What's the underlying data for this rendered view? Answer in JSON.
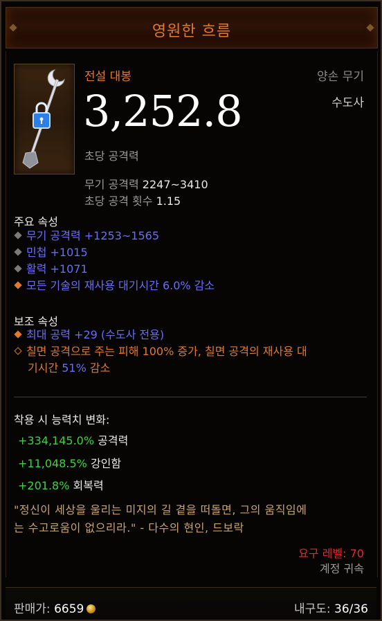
{
  "item": {
    "name": "영원한 흐름",
    "type": "전설 대봉",
    "slot": "양손 무기",
    "class": "수도사",
    "dps": "3,252.8",
    "dps_label": "초당 공격력",
    "damage_label": "무기 공격력",
    "damage_value": "2247~3410",
    "aps_label": "초당 공격 횟수",
    "aps_value": "1.15",
    "icon": "daibo-staff-with-lock-icon"
  },
  "primary": {
    "heading": "주요 속성",
    "affixes": [
      "무기 공격력 +1253~1565",
      "민첩 +1015",
      "활력 +1071",
      "모든 기술의 재사용 대기시간 6.0% 감소"
    ]
  },
  "secondary": {
    "heading": "보조 속성",
    "affixes": [
      "최대 공력 +29 (수도사 전용)"
    ],
    "legendary_text_a": "칠면 공격으로 주는 피해 100% 증가, 칠면 공격의 재사용 대",
    "legendary_text_b": "기시간 ",
    "legendary_value": "51%",
    "legendary_text_c": " 감소"
  },
  "changes": {
    "heading": "착용 시 능력치 변화:",
    "rows": [
      {
        "value": "+334,145.0%",
        "label": "공격력"
      },
      {
        "value": "+11,048.5%",
        "label": "강인함"
      },
      {
        "value": "+201.8%",
        "label": "회복력"
      }
    ]
  },
  "flavor": {
    "line1": "\"정신이 세상을 울리는 미지의 길 곁을 떠돌면, 그의 움직임에",
    "line2": "는 수고로움이 없으리라.\" - 다수의 현인, 드보락"
  },
  "requirements": {
    "level": "요구 레벨: 70",
    "bound": "계정 귀속"
  },
  "footer": {
    "price_label": "판매가:",
    "price_value": "6659",
    "durability_label": "내구도:",
    "durability_value": "36/36"
  },
  "colors": {
    "legendary": "#e0792f",
    "magic": "#6c6cf5",
    "positive": "#3ed23e",
    "requirement": "#e02a2a",
    "flavor": "#c9a56c"
  }
}
